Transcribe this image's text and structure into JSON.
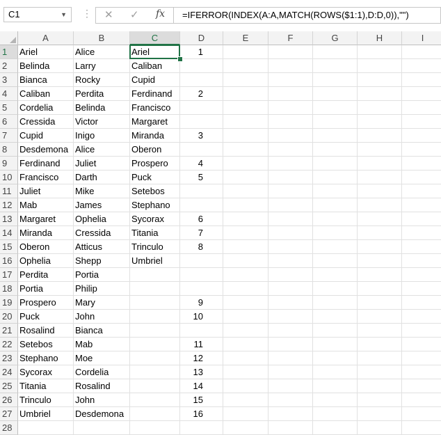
{
  "name_box": "C1",
  "formula": "=IFERROR(INDEX(A:A,MATCH(ROWS($1:1),D:D,0)),\"\")",
  "columns": [
    "A",
    "B",
    "C",
    "D",
    "E",
    "F",
    "G",
    "H",
    "I"
  ],
  "rows": [
    "1",
    "2",
    "3",
    "4",
    "5",
    "6",
    "7",
    "8",
    "9",
    "10",
    "11",
    "12",
    "13",
    "14",
    "15",
    "16",
    "17",
    "18",
    "19",
    "20",
    "21",
    "22",
    "23",
    "24",
    "25",
    "26",
    "27",
    "28"
  ],
  "colA": [
    "Ariel",
    "Belinda",
    "Bianca",
    "Caliban",
    "Cordelia",
    "Cressida",
    "Cupid",
    "Desdemona",
    "Ferdinand",
    "Francisco",
    "Juliet",
    "Mab",
    "Margaret",
    "Miranda",
    "Oberon",
    "Ophelia",
    "Perdita",
    "Portia",
    "Prospero",
    "Puck",
    "Rosalind",
    "Setebos",
    "Stephano",
    "Sycorax",
    "Titania",
    "Trinculo",
    "Umbriel",
    ""
  ],
  "colB": [
    "Alice",
    "Larry",
    "Rocky",
    "Perdita",
    "Belinda",
    "Victor",
    "Inigo",
    "Alice",
    "Juliet",
    "Darth",
    "Mike",
    "James",
    "Ophelia",
    "Cressida",
    "Atticus",
    "Shepp",
    "Portia",
    "Philip",
    "Mary",
    "John",
    "Bianca",
    "Mab",
    "Moe",
    "Cordelia",
    "Rosalind",
    "John",
    "Desdemona",
    ""
  ],
  "colC": [
    "Ariel",
    "Caliban",
    "Cupid",
    "Ferdinand",
    "Francisco",
    "Margaret",
    "Miranda",
    "Oberon",
    "Prospero",
    "Puck",
    "Setebos",
    "Stephano",
    "Sycorax",
    "Titania",
    "Trinculo",
    "Umbriel",
    "",
    "",
    "",
    "",
    "",
    "",
    "",
    "",
    "",
    "",
    "",
    ""
  ],
  "colD": [
    "1",
    "",
    "",
    "2",
    "",
    "",
    "3",
    "",
    "4",
    "5",
    "",
    "",
    "6",
    "7",
    "8",
    "",
    "",
    "",
    "9",
    "10",
    "",
    "11",
    "12",
    "13",
    "14",
    "15",
    "16",
    ""
  ]
}
